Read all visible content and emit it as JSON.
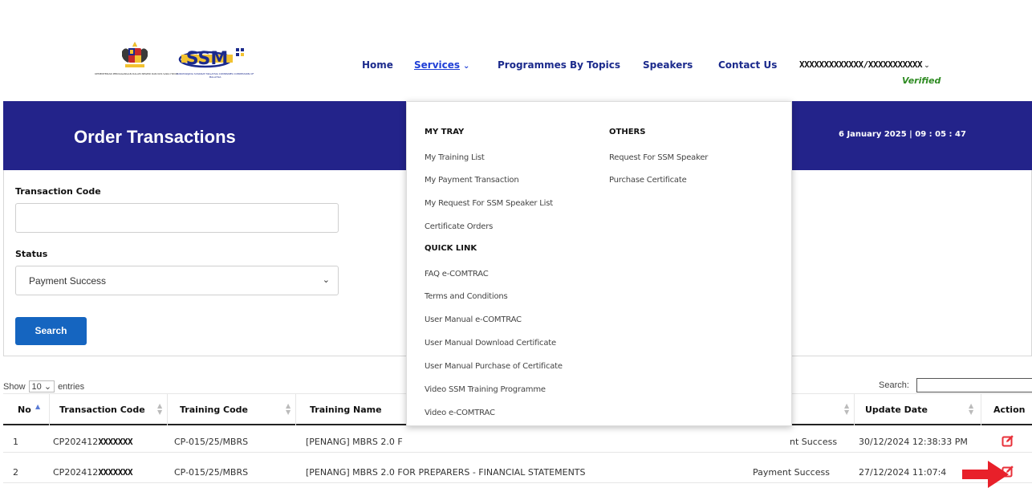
{
  "header": {
    "jata_caption": "KEMENTERIAN PERDAGANGAN DALAM NEGERI DAN KOS SARA HIDUP",
    "ssm_logo_text": "SSM",
    "ssm_caption": "SURUHANJAYA SYARIKAT MALAYSIA COMPANIES COMMISSION OF MALAYSIA",
    "nav": {
      "home": "Home",
      "services": "Services",
      "programmes": "Programmes By Topics",
      "speakers": "Speakers",
      "contact": "Contact Us"
    },
    "user_name": "XXXXXXXXXXXXX/XXXXXXXXXXX",
    "verified": "Verified"
  },
  "banner": {
    "title": "Order Transactions",
    "datetime": "6 January 2025 | 09 : 05 : 47"
  },
  "filters": {
    "transaction_code_label": "Transaction Code",
    "transaction_code_value": "",
    "status_label": "Status",
    "status_value": "Payment Success",
    "search_button": "Search"
  },
  "table": {
    "show_label": "Show",
    "entries_value": "10",
    "entries_label": "entries",
    "search_label": "Search:",
    "columns": {
      "no": "No",
      "transaction_code": "Transaction Code",
      "training_code": "Training Code",
      "training_name": "Training Name",
      "update_date": "Update Date",
      "action": "Action"
    },
    "rows": [
      {
        "no": "1",
        "transaction_code_prefix": "CP202412",
        "transaction_code_masked": "XXXXXXX",
        "training_code": "CP-015/25/MBRS",
        "training_name": "[PENANG] MBRS 2.0 F",
        "status": "nt Success",
        "update_date": "30/12/2024 12:38:33 PM"
      },
      {
        "no": "2",
        "transaction_code_prefix": "CP202412",
        "transaction_code_masked": "XXXXXXX",
        "training_code": "CP-015/25/MBRS",
        "training_name": "[PENANG] MBRS 2.0 FOR PREPARERS - FINANCIAL STATEMENTS",
        "status": "Payment Success",
        "update_date": "27/12/2024 11:07:4"
      }
    ]
  },
  "services_menu": {
    "my_tray_heading": "MY TRAY",
    "my_tray_items": [
      "My Training List",
      "My Payment Transaction",
      "My Request For SSM Speaker List",
      "Certificate Orders"
    ],
    "quick_link_heading": "QUICK LINK",
    "quick_link_items": [
      "FAQ e-COMTRAC",
      "Terms and Conditions",
      "User Manual e-COMTRAC",
      "User Manual Download Certificate",
      "User Manual Purchase of Certificate",
      "Video SSM Training Programme",
      "Video e-COMTRAC"
    ],
    "others_heading": "OTHERS",
    "others_items": [
      "Request For SSM Speaker",
      "Purchase Certificate"
    ]
  },
  "colors": {
    "banner": "#23238a",
    "nav_text": "#1b2a8c",
    "nav_active": "#1f3fd6",
    "search_button": "#1565c0",
    "verified": "#2e8b22",
    "edit_icon": "#e8313a",
    "arrow": "#e8202a"
  },
  "icons": {
    "edit": "edit-square-icon",
    "pointer": "red-arrow-icon"
  }
}
